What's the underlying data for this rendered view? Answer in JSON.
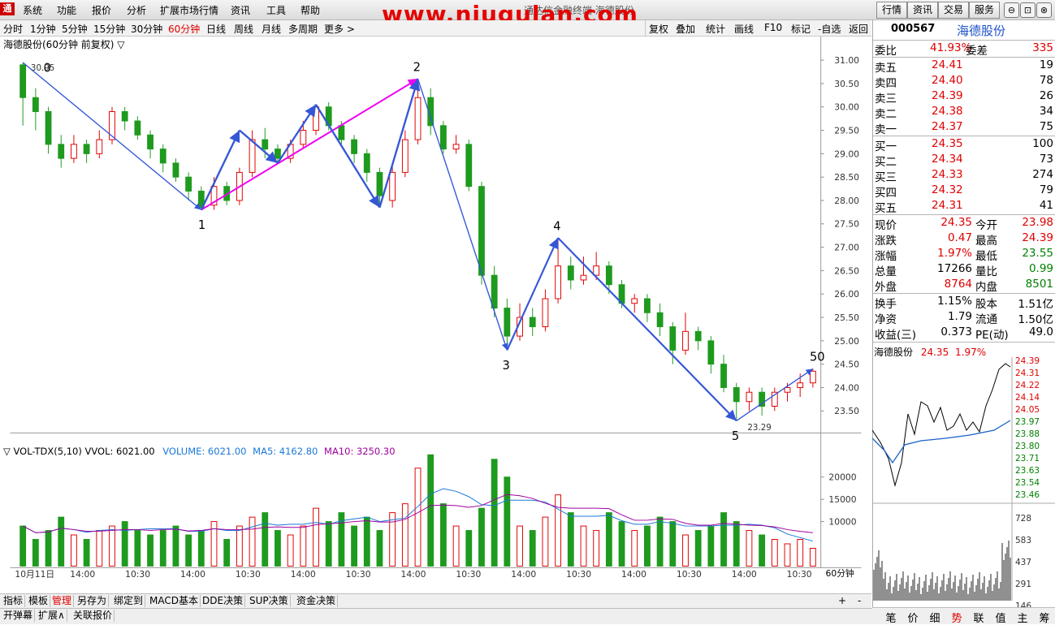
{
  "menu": {
    "items": [
      "系统",
      "功能",
      "报价",
      "分析",
      "扩展市场行情",
      "资讯",
      "工具",
      "帮助"
    ],
    "center_title": "通达信金融终端 海德股份",
    "watermark": "www.niugulan.com",
    "right_buttons": [
      "行情",
      "资讯",
      "交易",
      "服务"
    ],
    "window_buttons": [
      "⊖",
      "⊡",
      "⊗"
    ]
  },
  "toolbar": {
    "periods": [
      "分时",
      "1分钟",
      "5分钟",
      "15分钟",
      "30分钟",
      "60分钟",
      "日线",
      "周线",
      "月线",
      "多周期",
      "更多 >"
    ],
    "active_period": "60分钟",
    "actions": [
      "复权",
      "叠加",
      "统计",
      "画线",
      "F10",
      "标记",
      "-自选",
      "返回"
    ]
  },
  "chart": {
    "title": "海德股份(60分钟 前复权) ▽",
    "high_label": "30.95",
    "low_label": "23.29",
    "wave_labels": [
      "0",
      "1",
      "2",
      "3",
      "4",
      "5",
      "50"
    ],
    "volume_title": "▽ VOL-TDX(5,10) VVOL: 6021.00",
    "volume_volume": "VOLUME: 6021.00",
    "volume_ma5": "MA5: 4162.80",
    "volume_ma10": "MA10: 3250.30",
    "price_axis": [
      "31.00",
      "30.50",
      "30.00",
      "29.50",
      "29.00",
      "28.50",
      "28.00",
      "27.50",
      "27.00",
      "26.50",
      "26.00",
      "25.50",
      "25.00",
      "24.50",
      "24.00",
      "23.50"
    ],
    "volume_axis": [
      "20000",
      "15000",
      "10000"
    ],
    "time_axis": [
      "10月11日",
      "14:00",
      "10:30",
      "14:00",
      "10:30",
      "14:00",
      "10:30",
      "14:00",
      "10:30",
      "14:00",
      "10:30",
      "14:00",
      "10:30",
      "14:00",
      "10:30"
    ],
    "period_label": "60分钟",
    "colors": {
      "up": "#e00000",
      "down": "#1e9a1e",
      "wave": "#3557d6",
      "magenta": "#f000f0",
      "ma5": "#1a78d8",
      "ma10": "#a000a0"
    }
  },
  "chart_data": {
    "type": "candlestick",
    "title": "海德股份(60分钟 前复权)",
    "ylim": [
      23.2,
      31.2
    ],
    "candles": [
      [
        30.9,
        30.2,
        30.95,
        29.6
      ],
      [
        30.2,
        29.9,
        30.4,
        29.5
      ],
      [
        29.9,
        29.2,
        30.0,
        29.0
      ],
      [
        29.2,
        28.9,
        29.4,
        28.7
      ],
      [
        28.9,
        29.2,
        29.4,
        28.8
      ],
      [
        29.2,
        29.0,
        29.3,
        28.8
      ],
      [
        29.0,
        29.3,
        29.5,
        28.9
      ],
      [
        29.3,
        29.9,
        30.0,
        29.2
      ],
      [
        29.9,
        29.7,
        30.0,
        29.5
      ],
      [
        29.7,
        29.4,
        29.8,
        29.3
      ],
      [
        29.4,
        29.1,
        29.5,
        28.9
      ],
      [
        29.1,
        28.8,
        29.2,
        28.6
      ],
      [
        28.8,
        28.5,
        28.9,
        28.4
      ],
      [
        28.5,
        28.2,
        28.6,
        28.0
      ],
      [
        28.2,
        27.85,
        28.3,
        27.8
      ],
      [
        27.9,
        28.3,
        28.5,
        27.8
      ],
      [
        28.3,
        28.0,
        28.4,
        27.9
      ],
      [
        28.0,
        28.6,
        28.7,
        27.9
      ],
      [
        28.6,
        29.3,
        29.5,
        28.5
      ],
      [
        29.3,
        29.1,
        29.55,
        28.9
      ],
      [
        29.1,
        28.9,
        29.2,
        28.8
      ],
      [
        28.9,
        29.2,
        29.3,
        28.8
      ],
      [
        29.2,
        29.5,
        29.7,
        29.1
      ],
      [
        29.5,
        30.0,
        30.05,
        29.4
      ],
      [
        30.0,
        29.6,
        30.1,
        29.5
      ],
      [
        29.6,
        29.3,
        29.7,
        29.2
      ],
      [
        29.3,
        29.0,
        29.4,
        28.8
      ],
      [
        29.0,
        28.6,
        29.1,
        28.4
      ],
      [
        28.6,
        28.1,
        28.7,
        27.9
      ],
      [
        28.0,
        28.6,
        28.8,
        27.85
      ],
      [
        28.6,
        29.3,
        29.5,
        28.5
      ],
      [
        29.3,
        30.2,
        30.6,
        29.2
      ],
      [
        30.2,
        29.6,
        30.4,
        29.4
      ],
      [
        29.6,
        29.1,
        29.7,
        29.0
      ],
      [
        29.1,
        29.2,
        29.4,
        29.0
      ],
      [
        29.2,
        28.3,
        29.3,
        28.2
      ],
      [
        28.3,
        26.4,
        28.4,
        26.2
      ],
      [
        26.4,
        25.7,
        26.6,
        25.5
      ],
      [
        25.7,
        25.1,
        25.9,
        24.8
      ],
      [
        25.1,
        25.5,
        25.8,
        25.0
      ],
      [
        25.5,
        25.3,
        25.7,
        25.1
      ],
      [
        25.3,
        25.9,
        26.1,
        25.2
      ],
      [
        25.9,
        26.6,
        27.2,
        25.8
      ],
      [
        26.6,
        26.3,
        26.8,
        26.1
      ],
      [
        26.3,
        26.4,
        26.8,
        26.2
      ],
      [
        26.4,
        26.6,
        26.9,
        26.3
      ],
      [
        26.6,
        26.2,
        26.7,
        26.0
      ],
      [
        26.2,
        25.8,
        26.3,
        25.7
      ],
      [
        25.8,
        25.9,
        26.0,
        25.6
      ],
      [
        25.9,
        25.6,
        26.0,
        25.4
      ],
      [
        25.6,
        25.3,
        25.8,
        25.1
      ],
      [
        25.3,
        24.8,
        25.4,
        24.5
      ],
      [
        24.8,
        25.2,
        25.6,
        24.7
      ],
      [
        25.2,
        25.0,
        25.3,
        24.8
      ],
      [
        25.0,
        24.5,
        25.1,
        24.3
      ],
      [
        24.5,
        24.0,
        24.7,
        23.9
      ],
      [
        24.0,
        23.7,
        24.1,
        23.29
      ],
      [
        23.7,
        23.9,
        24.0,
        23.5
      ],
      [
        23.9,
        23.6,
        24.0,
        23.4
      ],
      [
        23.6,
        23.9,
        24.0,
        23.5
      ],
      [
        23.9,
        24.0,
        24.1,
        23.7
      ],
      [
        24.0,
        24.1,
        24.3,
        23.8
      ],
      [
        24.1,
        24.35,
        24.4,
        24.0
      ]
    ],
    "volume_values": [
      9,
      6,
      8,
      11,
      7,
      6,
      8,
      9,
      10,
      8,
      7,
      8,
      9,
      7,
      8,
      10,
      6,
      9,
      11,
      12,
      8,
      7,
      9,
      13,
      10,
      12,
      9,
      11,
      8,
      12,
      14,
      22,
      25,
      14,
      9,
      8,
      13,
      24,
      20,
      9,
      8,
      11,
      16,
      12,
      9,
      8,
      12,
      10,
      8,
      9,
      11,
      10,
      7,
      8,
      9,
      12,
      10,
      8,
      7,
      6,
      5,
      6,
      4
    ],
    "latest": {
      "VOLUME": 6021.0,
      "MA5": 4162.8,
      "MA10": 3250.3
    }
  },
  "quote": {
    "code": "000567",
    "name": "海德股份",
    "weibi_label": "委比",
    "weibi": "41.93%",
    "weicha_label": "委差",
    "weicha": "335",
    "asks": [
      {
        "label": "卖五",
        "price": "24.41",
        "vol": "19"
      },
      {
        "label": "卖四",
        "price": "24.40",
        "vol": "78"
      },
      {
        "label": "卖三",
        "price": "24.39",
        "vol": "26"
      },
      {
        "label": "卖二",
        "price": "24.38",
        "vol": "34"
      },
      {
        "label": "卖一",
        "price": "24.37",
        "vol": "75"
      }
    ],
    "bids": [
      {
        "label": "买一",
        "price": "24.35",
        "vol": "100"
      },
      {
        "label": "买二",
        "price": "24.34",
        "vol": "73"
      },
      {
        "label": "买三",
        "price": "24.33",
        "vol": "274"
      },
      {
        "label": "买四",
        "price": "24.32",
        "vol": "79"
      },
      {
        "label": "买五",
        "price": "24.31",
        "vol": "41"
      }
    ],
    "stats": [
      {
        "l1": "现价",
        "v1": "24.35",
        "c1": "red",
        "l2": "今开",
        "v2": "23.98",
        "c2": "red"
      },
      {
        "l1": "涨跌",
        "v1": "0.47",
        "c1": "red",
        "l2": "最高",
        "v2": "24.39",
        "c2": "red"
      },
      {
        "l1": "涨幅",
        "v1": "1.97%",
        "c1": "red",
        "l2": "最低",
        "v2": "23.55",
        "c2": "green"
      },
      {
        "l1": "总量",
        "v1": "17266",
        "c1": "black",
        "l2": "量比",
        "v2": "0.99",
        "c2": "green"
      },
      {
        "l1": "外盘",
        "v1": "8764",
        "c1": "red",
        "l2": "内盘",
        "v2": "8501",
        "c2": "green"
      }
    ],
    "stats2": [
      {
        "l1": "换手",
        "v1": "1.15%",
        "l2": "股本",
        "v2": "1.51亿"
      },
      {
        "l1": "净资",
        "v1": "1.79",
        "l2": "流通",
        "v2": "1.50亿"
      },
      {
        "l1": "收益(三)",
        "v1": "0.373",
        "l2": "PE(动)",
        "v2": "49.0"
      }
    ],
    "mini_title": "海德股份",
    "mini_price": "24.35",
    "mini_pct": "1.97%",
    "mini_axis": [
      "24.39",
      "24.31",
      "24.22",
      "24.14",
      "24.05",
      "23.97",
      "23.88",
      "23.80",
      "23.71",
      "23.63",
      "23.54",
      "23.46"
    ],
    "mini_vol_axis": [
      "728",
      "583",
      "437",
      "291",
      "146"
    ]
  },
  "bottom": {
    "tabs1": [
      "指标",
      "模板",
      "管理",
      "另存为",
      "绑定到",
      "MACD基本",
      "DDE决策",
      "SUP决策",
      "资金决策"
    ],
    "tabs2": [
      "开弹幕",
      "扩展∧",
      "关联报价"
    ],
    "right_tabs": [
      "笔",
      "价",
      "细",
      "势",
      "联",
      "值",
      "主",
      "筹"
    ],
    "active_right_tab": "势",
    "zoom": [
      "+",
      "-"
    ]
  }
}
